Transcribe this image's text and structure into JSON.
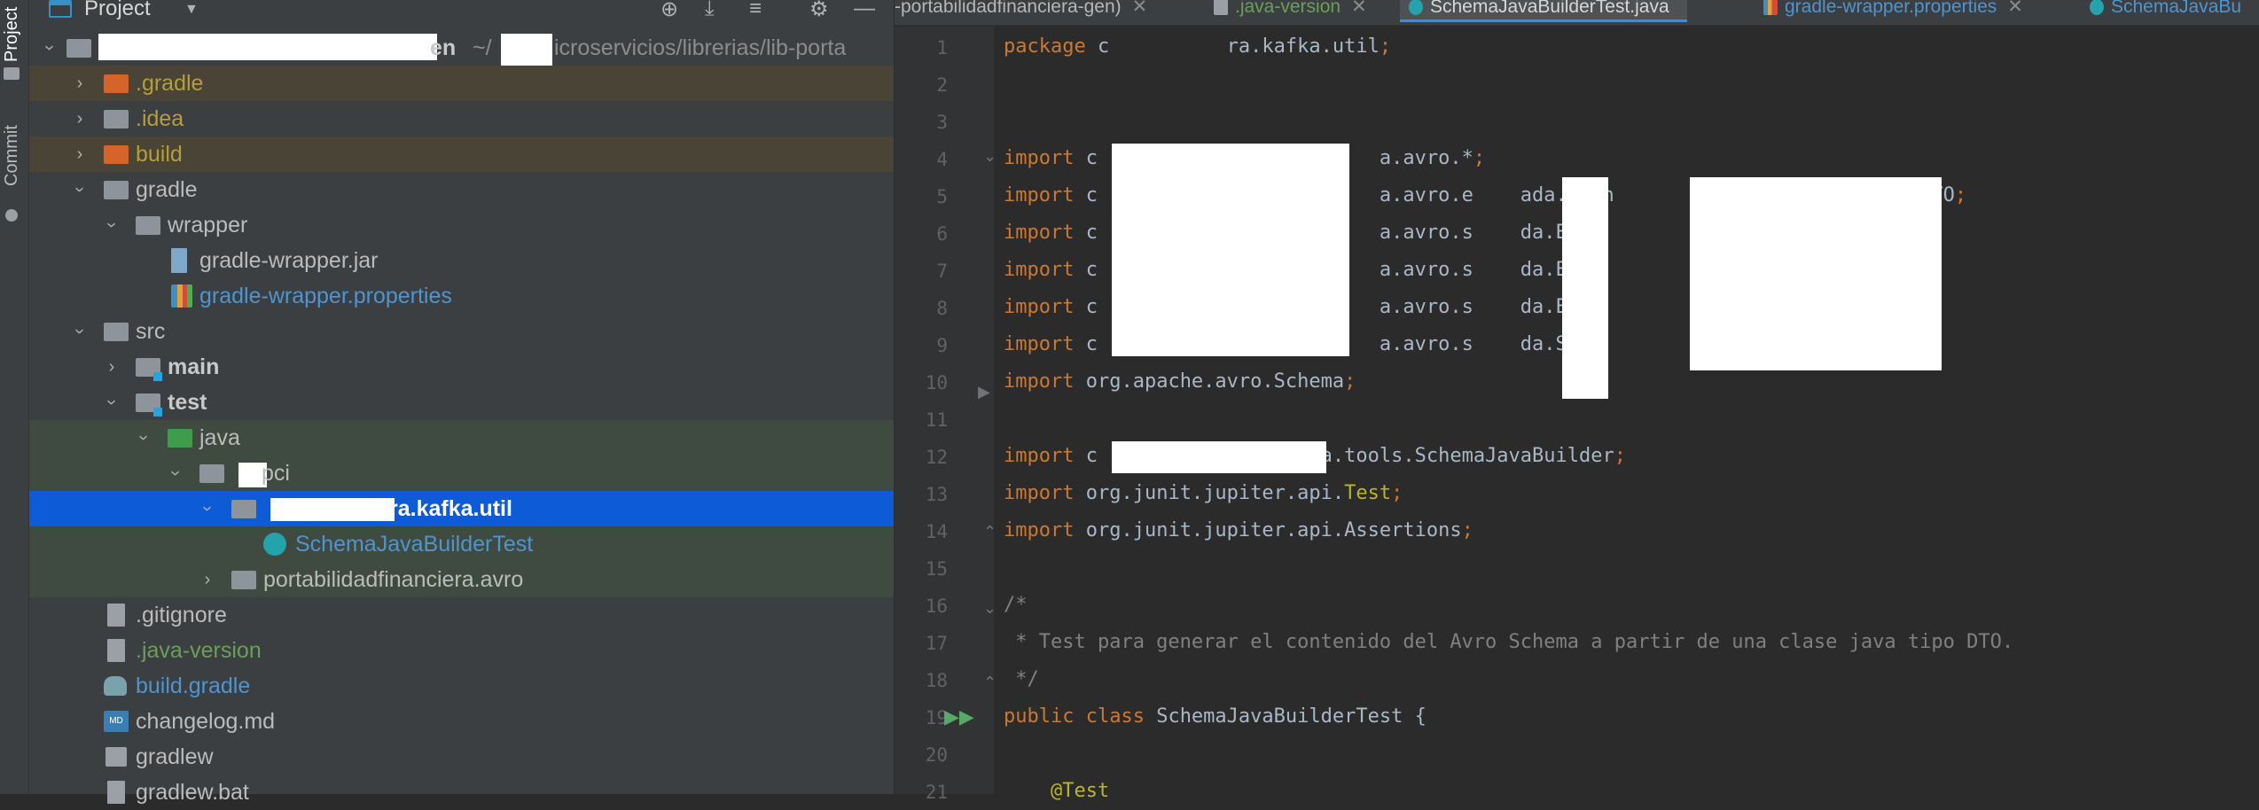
{
  "sidebar_strip": {
    "project_label": "Project",
    "commit_label": "Commit"
  },
  "project_pane": {
    "title": "Project",
    "tree": [
      {
        "label": "en",
        "path": "~/",
        "path2": "icroservicios/librerias/lib-porta"
      },
      {
        "label": ".gradle"
      },
      {
        "label": ".idea"
      },
      {
        "label": "build"
      },
      {
        "label": "gradle"
      },
      {
        "label": "wrapper"
      },
      {
        "label": "gradle-wrapper.jar"
      },
      {
        "label": "gradle-wrapper.properties"
      },
      {
        "label": "src"
      },
      {
        "label": "main"
      },
      {
        "label": "test"
      },
      {
        "label": "java"
      },
      {
        "label": "pci"
      },
      {
        "label": "ra.kafka.util"
      },
      {
        "label": "SchemaJavaBuilderTest"
      },
      {
        "label": "portabilidadfinanciera.avro"
      },
      {
        "label": ".gitignore"
      },
      {
        "label": ".java-version"
      },
      {
        "label": "build.gradle"
      },
      {
        "label": "changelog.md"
      },
      {
        "label": "gradlew"
      },
      {
        "label": "gradlew.bat"
      }
    ]
  },
  "editor": {
    "tabs": [
      {
        "label": "-portabilidadfinanciera-gen)"
      },
      {
        "label": ".java-version"
      },
      {
        "label": "SchemaJavaBuilderTest.java"
      },
      {
        "label": "gradle-wrapper.properties"
      },
      {
        "label": "SchemaJavaBu"
      }
    ],
    "lines": [
      {
        "n": "1",
        "text": "package c          ra.kafka.util;"
      },
      {
        "n": "2",
        "text": ""
      },
      {
        "n": "3",
        "text": ""
      },
      {
        "n": "4",
        "text": "import c                        a.avro.*;"
      },
      {
        "n": "5",
        "text": "import c                        a.avro.e    ada.Even               idadEntradaDTO;"
      },
      {
        "n": "6",
        "text": "import c                        a.avro.s    da.Even               O;"
      },
      {
        "n": "7",
        "text": "import c                        a.avro.s    da.Even               umplirDTO;"
      },
      {
        "n": "8",
        "text": "import c                        a.avro.s    da.Even               O;"
      },
      {
        "n": "9",
        "text": "import c                        a.avro.s    da.Soli               idaDTO;"
      },
      {
        "n": "10",
        "text": "import org.apache.avro.Schema;"
      },
      {
        "n": "11",
        "text": ""
      },
      {
        "n": "12",
        "text": "import c            ra.kafka.tools.SchemaJavaBuilder;"
      },
      {
        "n": "13",
        "text": "import org.junit.jupiter.api.Test;"
      },
      {
        "n": "14",
        "text": "import org.junit.jupiter.api.Assertions;"
      },
      {
        "n": "15",
        "text": ""
      },
      {
        "n": "16",
        "text": "/*"
      },
      {
        "n": "17",
        "text": " * Test para generar el contenido del Avro Schema a partir de una clase java tipo DTO."
      },
      {
        "n": "18",
        "text": " */"
      },
      {
        "n": "19",
        "text": "public class SchemaJavaBuilderTest {"
      },
      {
        "n": "20",
        "text": ""
      },
      {
        "n": "21",
        "text": "    @Test"
      }
    ]
  },
  "colors": {
    "selection": "#0e5bd8",
    "keyword": "#cc7832",
    "comment": "#808080",
    "annotation": "#bbb529",
    "folder_green": "#3d9d4a",
    "folder_orange": "#d4642a"
  }
}
